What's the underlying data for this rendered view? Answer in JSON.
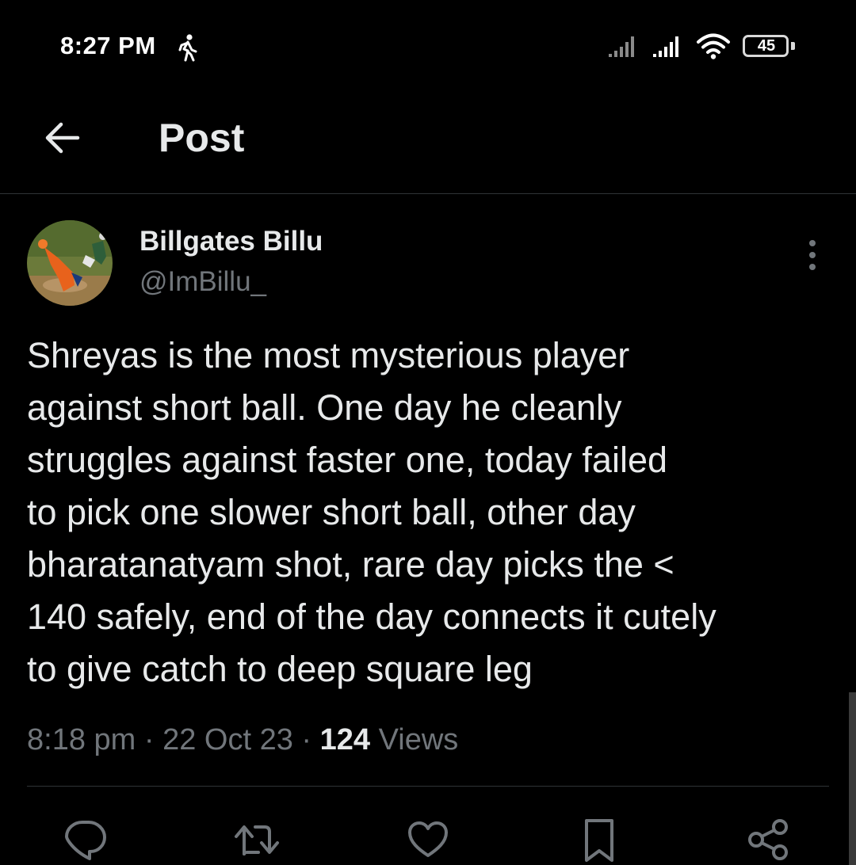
{
  "status_bar": {
    "time": "8:27 PM",
    "battery_level": "45",
    "icons": [
      "walk-icon",
      "signal-icon",
      "signal-icon",
      "wifi-icon",
      "battery-icon"
    ]
  },
  "header": {
    "title": "Post",
    "back_icon": "arrow-left-icon"
  },
  "post": {
    "author": {
      "name": "Billgates Billu",
      "handle": "@ImBillu_"
    },
    "text": "Shreyas is the most mysterious player\nagainst short ball. One day he cleanly\nstruggles against faster one, today failed\nto pick one slower short ball, other day\nbharatanatyam shot, rare day picks the <\n140 safely, end of the day connects it cutely\nto give catch to deep square leg",
    "time": "8:18 pm",
    "separator": "·",
    "date": "22 Oct 23",
    "views_count": "124",
    "views_label": "Views"
  },
  "actions": [
    "reply-icon",
    "retweet-icon",
    "like-icon",
    "bookmark-icon",
    "share-icon"
  ],
  "colors": {
    "background": "#000000",
    "text_primary": "#e7e9ea",
    "text_secondary": "#71767b",
    "divider": "#2f3336"
  }
}
